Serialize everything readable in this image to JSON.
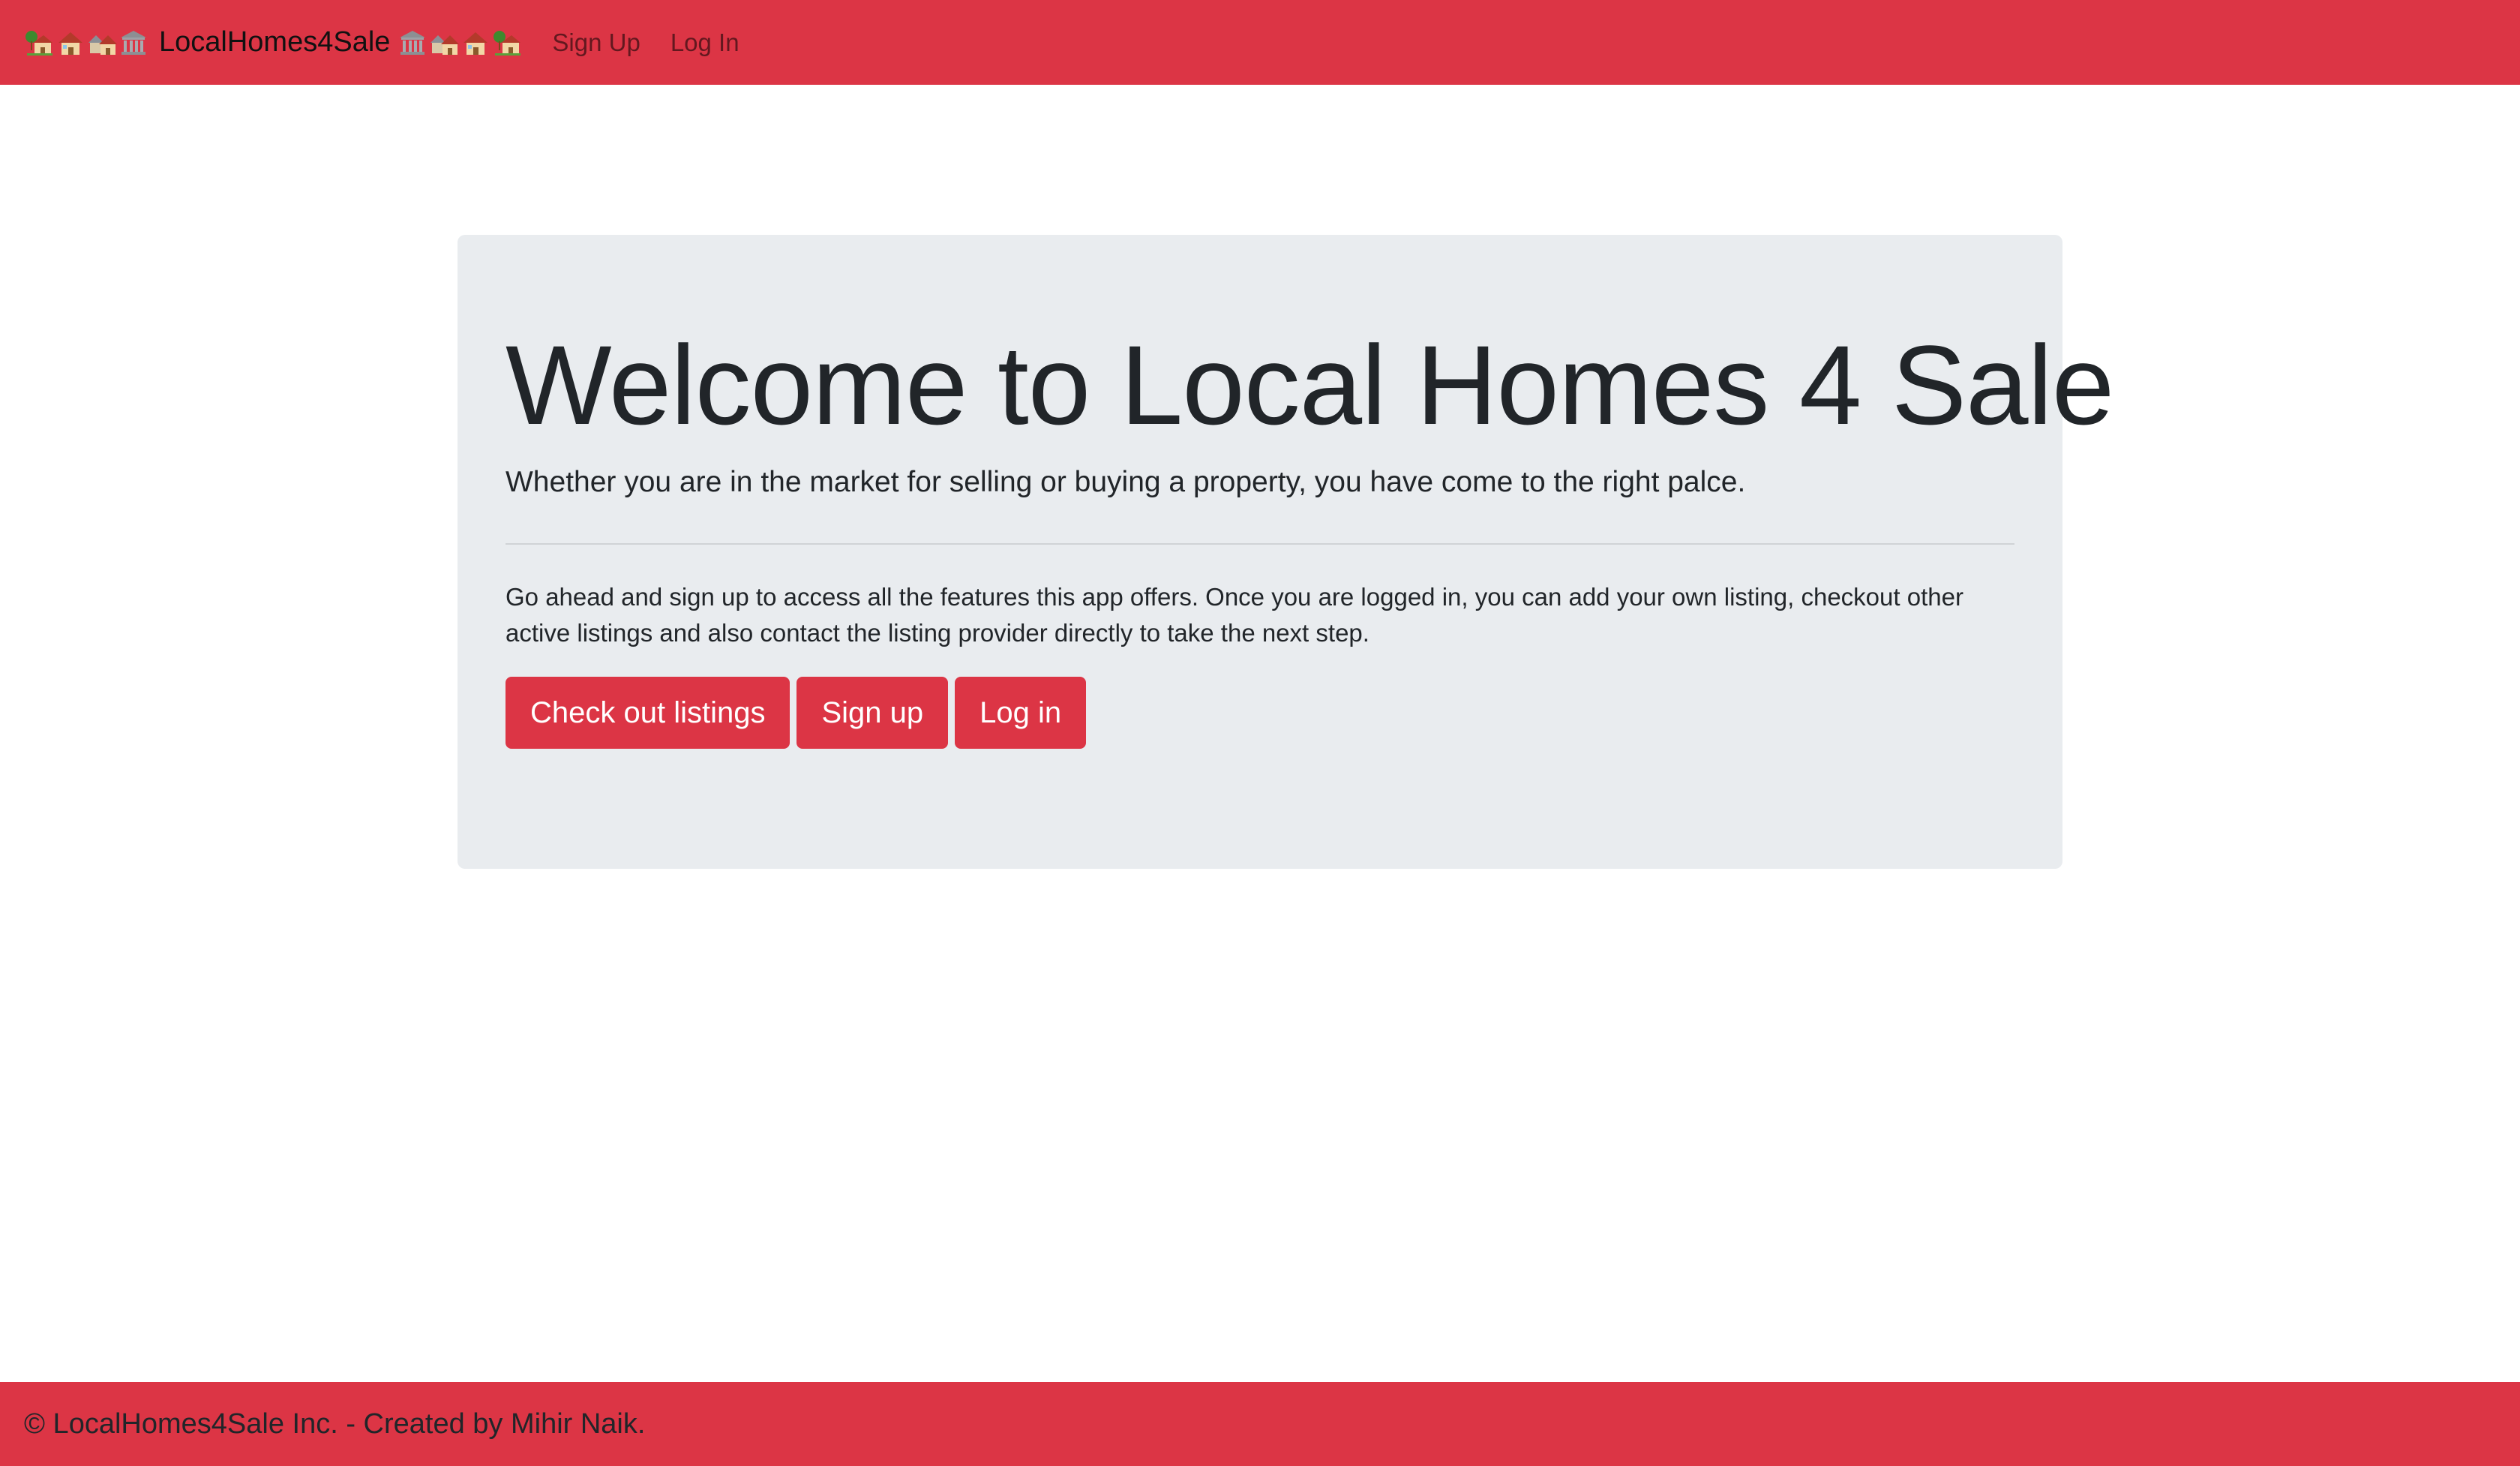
{
  "navbar": {
    "brand_left_icons": [
      "house-with-garden-icon",
      "house-icon",
      "houses-icon",
      "classical-building-icon"
    ],
    "brand_text": "LocalHomes4Sale",
    "brand_right_icons": [
      "classical-building-icon",
      "houses-icon",
      "house-icon",
      "house-with-garden-icon"
    ],
    "links": [
      {
        "label": "Sign Up"
      },
      {
        "label": "Log In"
      }
    ],
    "background_color": "#dc3545"
  },
  "hero": {
    "title": "Welcome to Local Homes 4 Sale",
    "lead": "Whether you are in the market for selling or buying a property, you have come to the right palce.",
    "body": "Go ahead and sign up to access all the features this app offers. Once you are logged in, you can add your own listing, checkout other active listings and also contact the listing provider directly to take the next step.",
    "buttons": {
      "listings": "Check out listings",
      "signup": "Sign up",
      "login": "Log in"
    },
    "background_color": "#e9ecef"
  },
  "footer": {
    "text": "© LocalHomes4Sale Inc. - Created by Mihir Naik."
  }
}
